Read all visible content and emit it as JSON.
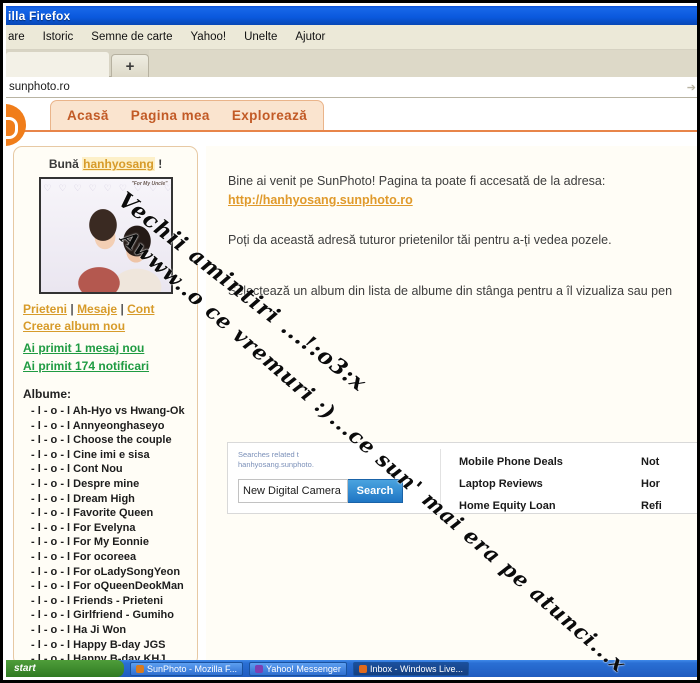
{
  "browser": {
    "title": "illa Firefox",
    "menu": [
      "are",
      "Istoric",
      "Semne de carte",
      "Yahoo!",
      "Unelte",
      "Ajutor"
    ],
    "newtab_label": "+",
    "url_value": "sunphoto.ro",
    "url_placeholder": "sunphoto.ro"
  },
  "site": {
    "nav": [
      "Acasă",
      "Pagina mea",
      "Explorează"
    ],
    "sidebar": {
      "greeting_prefix": "Bună",
      "username": "hanhyosang",
      "greeting_suffix": "!",
      "photo_caption": "\"For My Uncle\"",
      "links": [
        "Prieteni",
        "Mesaje",
        "Cont"
      ],
      "separator": "|",
      "create_album": "Creare album nou",
      "notice_messages": "Ai primit 1 mesaj nou",
      "notice_notifications": "Ai primit 174 notificari",
      "albums_title": "Albume:",
      "albums": [
        "- l - o - l Ah-Hyo vs Hwang-Ok",
        "- l - o - l Annyeonghaseyo",
        "- l - o - l Choose the couple",
        "- l - o - l Cine imi e sisa",
        "- l - o - l Cont Nou",
        "- l - o - l Despre mine",
        "- l - o - l Dream High",
        "- l - o - l Favorite Queen",
        "- l - o - l For Evelyna",
        "- l - o - l For My Eonnie",
        "- l - o - l For ocoreea",
        "- l - o - l For oLadySongYeon",
        "- l - o - l For oQueenDeokMan",
        "- l - o - l Friends - Prieteni",
        "- l - o - l Girlfriend - Gumiho",
        "- l - o - l Ha Ji Won",
        "- l - o - l Happy B-day JGS",
        "- l - o - l Happy B-day KHJ"
      ]
    },
    "main": {
      "welcome_line": "Bine ai venit pe SunPhoto! Pagina ta poate fi accesată de la adresa:",
      "profile_url": "http://hanhyosang.sunphoto.ro",
      "share_line": "Poți da această adresă tuturor prietenilor tăi pentru a-ți vedea pozele.",
      "select_line": "Selectează un album din lista de albume din stânga pentru a îl vizualiza sau pen"
    }
  },
  "ad": {
    "related_line1": "Searches related t",
    "related_line2": "hanhyosang.sunphoto.",
    "search_value": "New Digital Camera",
    "search_placeholder": "New Digital Camera",
    "search_button": "Search",
    "links_col1": [
      "Mobile Phone Deals",
      "Laptop Reviews",
      "Home Equity Loan"
    ],
    "links_col2": [
      "Not",
      "Hor",
      "Refi"
    ]
  },
  "annotation": {
    "line1": "Vechii amintiri ...!:o3:x",
    "line2": "Awww..o ce vremuri :)...ce sun' mai era pe atunci...x"
  },
  "taskbar": {
    "start_label": "start",
    "buttons": [
      {
        "label": "SunPhoto - Mozilla F...",
        "color": "#d87a1e"
      },
      {
        "label": "Yahoo! Messenger",
        "color": "#7c3fb2"
      },
      {
        "label": "Inbox - Windows Live...",
        "color": "#1d6fd0"
      }
    ]
  },
  "colors": {
    "accent_orange": "#e8854a",
    "link_gold": "#d79b2a",
    "notice_green": "#1f9b42",
    "titlebar_blue": "#0a4fd6"
  }
}
